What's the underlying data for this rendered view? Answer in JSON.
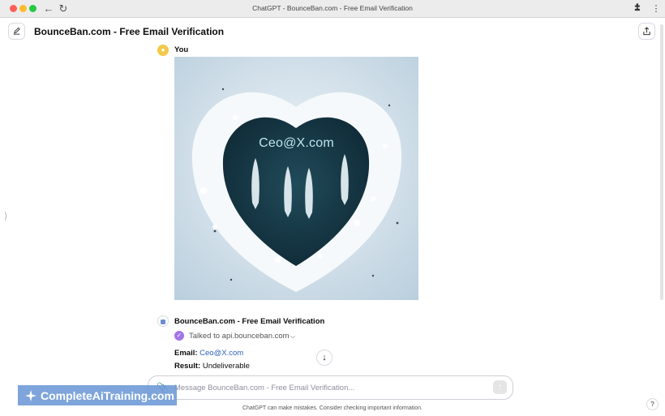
{
  "window": {
    "title": "ChatGPT - BounceBan.com - Free Email Verification"
  },
  "header": {
    "model_name": "BounceBan.com - Free Email Verification"
  },
  "user_message": {
    "sender": "You",
    "image_overlay_text": "Ceo@X.com"
  },
  "assistant_message": {
    "sender": "BounceBan.com - Free Email Verification",
    "tool_call": "Talked to api.bounceban.com",
    "email_label": "Email:",
    "email_value": "Ceo@X.com",
    "result_label": "Result:",
    "result_value": "Undeliverable"
  },
  "composer": {
    "placeholder": "Message BounceBan.com - Free Email Verification..."
  },
  "footer": {
    "disclaimer": "ChatGPT can make mistakes. Consider checking important information.",
    "help_label": "?"
  },
  "watermark": {
    "text": "CompleteAiTraining.com"
  },
  "icons": {
    "new_chat": "edit-icon",
    "share": "share-icon",
    "extensions": "puzzle-icon",
    "menu": "kebab-icon",
    "attach": "paperclip-icon",
    "send": "arrow-up-icon",
    "scroll_down": "arrow-down-icon"
  },
  "colors": {
    "accent_purple": "#a374e8",
    "link": "#2b5fbf",
    "watermark_bg": "#6c99d6"
  }
}
